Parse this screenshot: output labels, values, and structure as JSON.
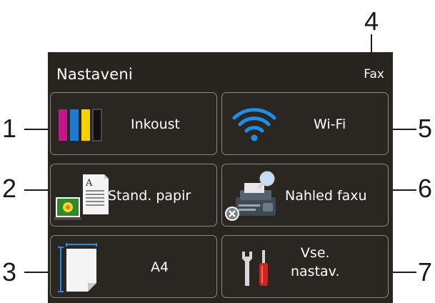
{
  "screen": {
    "title": "Nastaveni",
    "mode_label": "Fax"
  },
  "tiles": {
    "ink": {
      "label": "Inkoust",
      "icon": "ink-cartridges-icon",
      "colors": [
        "#c2188c",
        "#1b7bd2",
        "#f5d300",
        "#111111"
      ]
    },
    "wifi": {
      "label": "Wi-Fi",
      "icon": "wifi-icon",
      "color": "#1f8ee8"
    },
    "paper": {
      "label": "Stand. papir",
      "icon": "paper-type-icon"
    },
    "fax_preview": {
      "label": "Nahled faxu",
      "icon": "fax-preview-icon"
    },
    "paper_size": {
      "label": "A4",
      "icon": "paper-size-icon"
    },
    "all_settings": {
      "label_line1": "Vse.",
      "label_line2": "nastav.",
      "icon": "wrench-screwdriver-icon"
    }
  },
  "callouts": [
    "1",
    "2",
    "3",
    "4",
    "5",
    "6",
    "7"
  ]
}
